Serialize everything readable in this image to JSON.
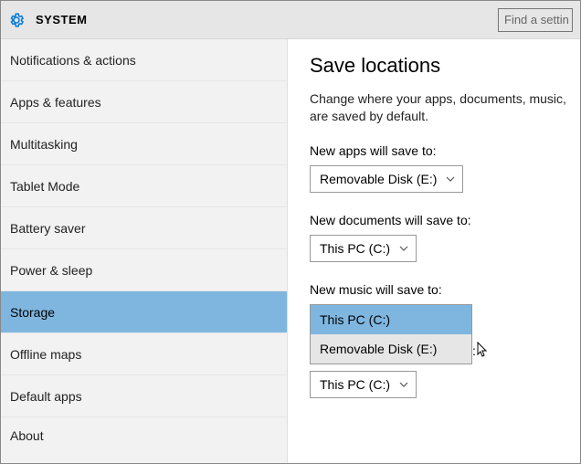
{
  "header": {
    "title": "SYSTEM",
    "search_placeholder": "Find a settin"
  },
  "sidebar": {
    "items": [
      {
        "label": "Notifications & actions"
      },
      {
        "label": "Apps & features"
      },
      {
        "label": "Multitasking"
      },
      {
        "label": "Tablet Mode"
      },
      {
        "label": "Battery saver"
      },
      {
        "label": "Power & sleep"
      },
      {
        "label": "Storage",
        "selected": true
      },
      {
        "label": "Offline maps"
      },
      {
        "label": "Default apps"
      },
      {
        "label": "About"
      }
    ]
  },
  "main": {
    "heading": "Save locations",
    "description": "Change where your apps, documents, music, are saved by default.",
    "fields": {
      "apps": {
        "label": "New apps will save to:",
        "value": "Removable Disk (E:)"
      },
      "documents": {
        "label": "New documents will save to:",
        "value": "This PC (C:)"
      },
      "music": {
        "label": "New music will save to:",
        "options": [
          "This PC (C:)",
          "Removable Disk (E:)"
        ],
        "selected_option": "This PC (C:)",
        "hover_option": "Removable Disk (E:)"
      },
      "extra_dropdown_value": "This PC (C:)"
    }
  },
  "icons": {
    "gear": "gear-icon",
    "chevron": "chevron-down-icon",
    "cursor": "mouse-cursor"
  },
  "colors": {
    "selection": "#7fb6e0",
    "panel_bg": "#f2f2f2",
    "header_bg": "#e6e6e6"
  }
}
